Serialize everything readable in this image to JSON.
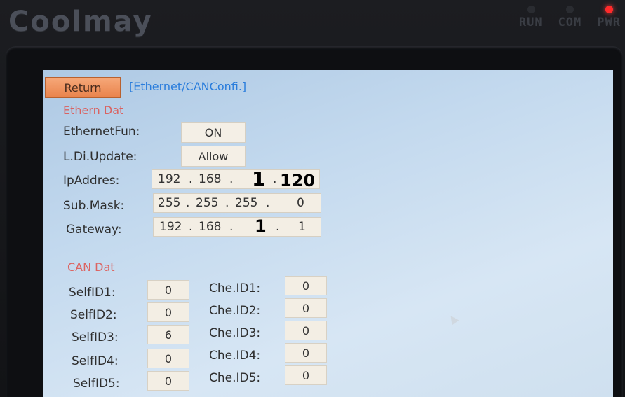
{
  "device": {
    "brand": "Coolmay",
    "indicators": [
      {
        "label": "RUN",
        "led": "off"
      },
      {
        "label": "COM",
        "led": "off"
      },
      {
        "label": "PWR",
        "led": "on",
        "led_color": "#ff2a2a"
      }
    ]
  },
  "screen": {
    "return_label": "Return",
    "title": "[Ethernet/CANConfi.]",
    "ethernet_section": "Ethern Dat",
    "ethernet": {
      "fun_label": "EthernetFun:",
      "fun_value": "ON",
      "update_label": "L.Di.Update:",
      "update_value": "Allow",
      "ip_label": "IpAddres:",
      "ip": [
        "192",
        "168",
        "1",
        "120"
      ],
      "mask_label": "Sub.Mask:",
      "mask": [
        "255",
        "255",
        "255",
        "0"
      ],
      "gateway_label": "Gateway:",
      "gateway": [
        "192",
        "168",
        "1",
        "1"
      ]
    },
    "can_section": "CAN Dat",
    "can": {
      "self_labels": [
        "SelfID1:",
        "SelfID2:",
        "SelfID3:",
        "SelfID4:",
        "SelfID5:"
      ],
      "self_values": [
        "0",
        "0",
        "6",
        "0",
        "0"
      ],
      "che_labels": [
        "Che.ID1:",
        "Che.ID2:",
        "Che.ID3:",
        "Che.ID4:",
        "Che.ID5:"
      ],
      "che_values": [
        "0",
        "0",
        "0",
        "0",
        "0"
      ]
    }
  },
  "colors": {
    "return_button": "#e9834c",
    "title": "#2a7ddc",
    "section_heading": "#e0504a",
    "screen_bg": "#c3d9ee"
  }
}
